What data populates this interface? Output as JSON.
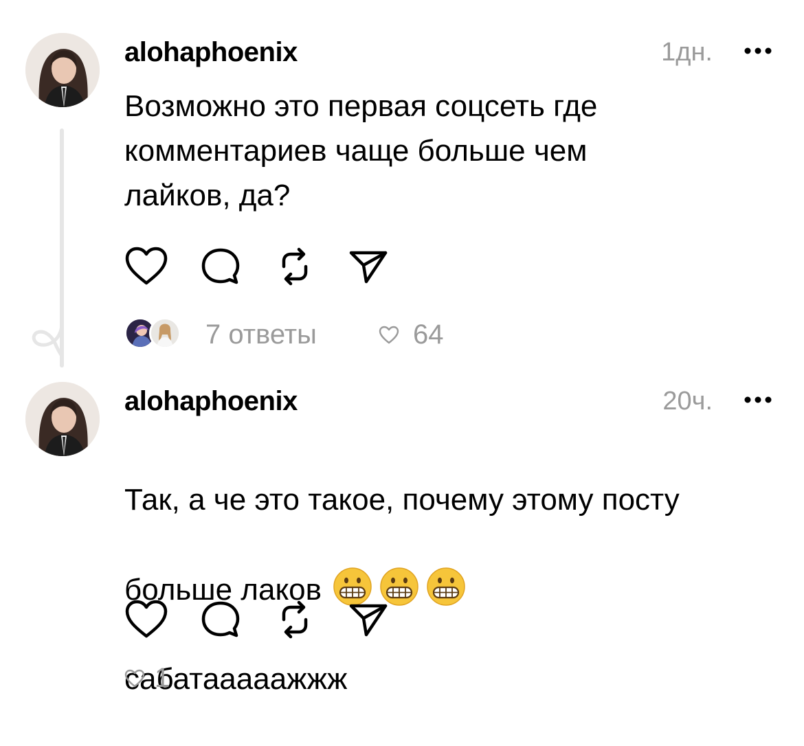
{
  "comments": [
    {
      "username": "alohaphoenix",
      "time": "1дн.",
      "text": "Возможно это первая соцсеть где\nкомментариев чаще больше чем\nлайков, да?",
      "emojis": [],
      "replies": "7 ответы",
      "likes": "64",
      "icons": [
        "heart-icon",
        "comment-icon",
        "repost-icon",
        "share-icon",
        "more-icon"
      ]
    },
    {
      "username": "alohaphoenix",
      "time": "20ч.",
      "text_line1": "Так, а че это такое, почему этому посту",
      "text_line2": "больше лаков",
      "text_line3": "сабатааааажжж",
      "emojis": [
        "😬",
        "😬",
        "😬"
      ],
      "likes": "1",
      "icons": [
        "heart-icon",
        "comment-icon",
        "repost-icon",
        "share-icon",
        "more-icon"
      ]
    }
  ],
  "colors": {
    "text": "#000000",
    "muted": "#9a9a9a",
    "thread_line": "#e6e6e6",
    "background": "#ffffff"
  }
}
